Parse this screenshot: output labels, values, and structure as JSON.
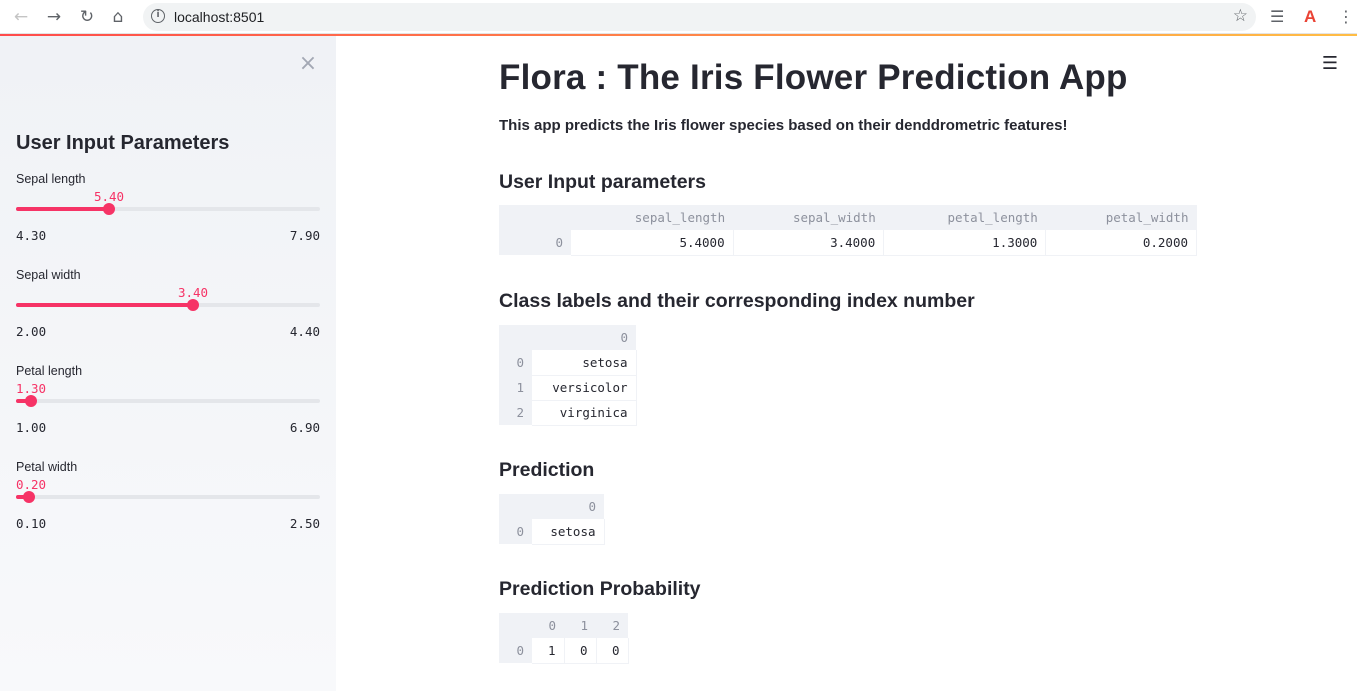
{
  "browser": {
    "back_icon": "arrow-left-icon",
    "forward_icon": "arrow-right-icon",
    "reload_icon": "reload-icon",
    "home_icon": "home-icon",
    "url": "localhost:8501"
  },
  "sidebar": {
    "title": "User Input Parameters",
    "sliders": [
      {
        "label": "Sepal length",
        "value": "5.40",
        "min": "4.30",
        "max": "7.90",
        "fraction": 0.3056
      },
      {
        "label": "Sepal width",
        "value": "3.40",
        "min": "2.00",
        "max": "4.40",
        "fraction": 0.5833
      },
      {
        "label": "Petal length",
        "value": "1.30",
        "min": "1.00",
        "max": "6.90",
        "fraction": 0.0508
      },
      {
        "label": "Petal width",
        "value": "0.20",
        "min": "0.10",
        "max": "2.50",
        "fraction": 0.0417
      }
    ]
  },
  "main": {
    "title": "Flora : The Iris Flower Prediction App",
    "intro": "This app predicts the Iris flower species based on their denddrometric features!",
    "sections": {
      "input": {
        "heading": "User Input parameters",
        "columns": [
          "sepal_length",
          "sepal_width",
          "petal_length",
          "petal_width"
        ],
        "rows": [
          {
            "index": "0",
            "cells": [
              "5.4000",
              "3.4000",
              "1.3000",
              "0.2000"
            ]
          }
        ]
      },
      "classes": {
        "heading": "Class labels and their corresponding index number",
        "columns": [
          "0"
        ],
        "rows": [
          {
            "index": "0",
            "cells": [
              "setosa"
            ]
          },
          {
            "index": "1",
            "cells": [
              "versicolor"
            ]
          },
          {
            "index": "2",
            "cells": [
              "virginica"
            ]
          }
        ]
      },
      "prediction": {
        "heading": "Prediction",
        "columns": [
          "0"
        ],
        "rows": [
          {
            "index": "0",
            "cells": [
              "setosa"
            ]
          }
        ]
      },
      "probability": {
        "heading": "Prediction Probability",
        "columns": [
          "0",
          "1",
          "2"
        ],
        "rows": [
          {
            "index": "0",
            "cells": [
              "1",
              "0",
              "0"
            ]
          }
        ]
      }
    }
  },
  "colors": {
    "accent": "#f63366",
    "sidebar_bg": "#f0f2f6",
    "text": "#262730",
    "index_text": "#8d919d"
  }
}
